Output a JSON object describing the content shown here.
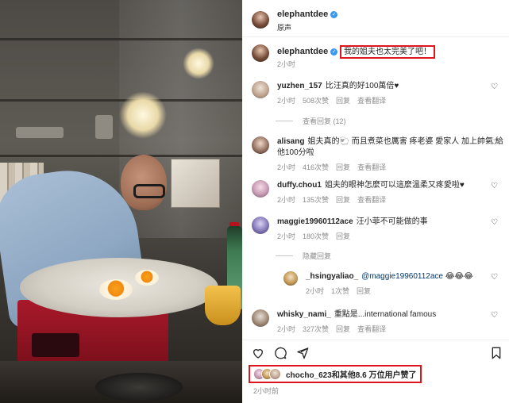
{
  "header": {
    "username": "elephantdee",
    "verified_mark": "✓",
    "subtitle": "原声"
  },
  "caption": {
    "username": "elephantdee",
    "text": "我的姐夫也太完美了吧！",
    "time": "2小时"
  },
  "comments": [
    {
      "username": "yuzhen_157",
      "text": "比汪真的好100萬倍♥",
      "time": "2小时",
      "likes": "508次赞",
      "reply": "回复",
      "translate": "查看翻译"
    },
    {
      "username": "alisang",
      "text": "姐夫真的🐑 而且煮菜也厲害 疼老婆 愛家人 加上帥氣 給他100分啦",
      "time": "2小时",
      "likes": "416次赞",
      "reply": "回复",
      "translate": "查看翻译"
    },
    {
      "username": "duffy.chou1",
      "text": "姐夫的眼神怎麼可以這麼溫柔又疼愛啦♥",
      "time": "2小时",
      "likes": "135次赞",
      "reply": "回复",
      "translate": "查看翻译"
    },
    {
      "username": "maggie19960112ace",
      "text": "汪小菲不可能做的事",
      "time": "2小时",
      "likes": "180次赞",
      "reply": "回复",
      "translate": ""
    },
    {
      "username": "whisky_nami_",
      "text": "重點是...international famous",
      "time": "2小时",
      "likes": "327次赞",
      "reply": "回复",
      "translate": "查看翻译"
    }
  ],
  "view_replies": "查看回复 (12)",
  "hide_replies": "隐藏回复",
  "reply": {
    "username": "_hsingyaliao_",
    "mention": "@maggie19960112ace",
    "text": "😂😂😂",
    "time": "2小时",
    "likes": "1次赞",
    "reply": "回复"
  },
  "likes": {
    "user": "chocho_623",
    "text": "和其他8.6 万位用户赞了"
  },
  "post_time": "2小时前",
  "icons": {
    "heart": "heart-icon",
    "comment": "comment-icon",
    "share": "share-icon",
    "save": "bookmark-icon"
  },
  "colors": {
    "highlight": "#e0141c",
    "verified": "#3897f0"
  }
}
